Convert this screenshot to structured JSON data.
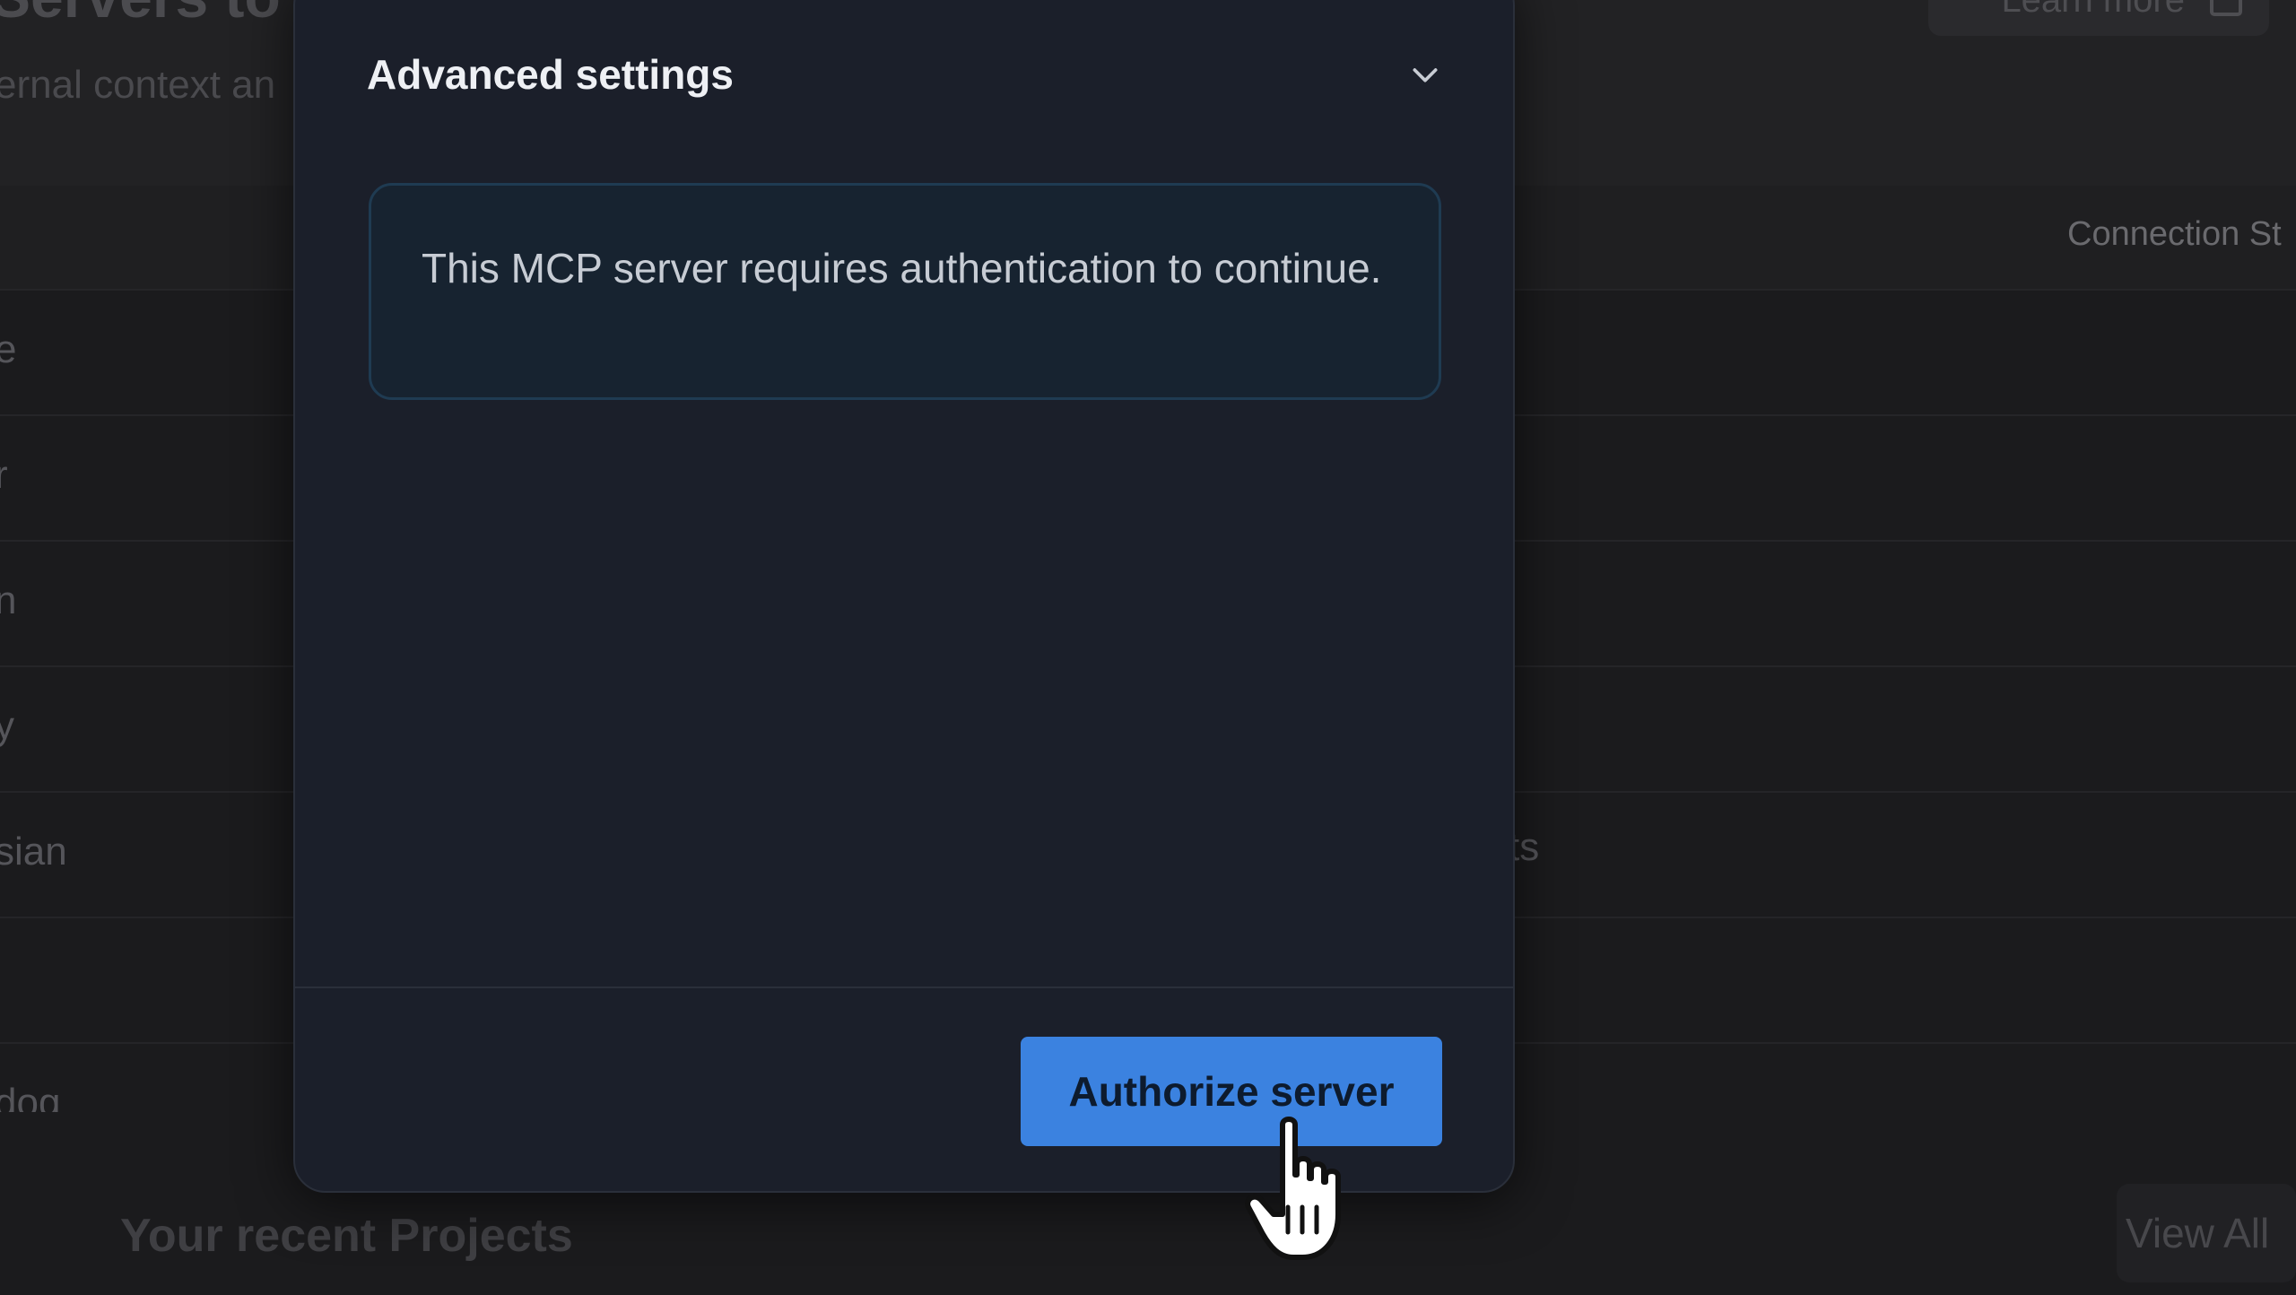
{
  "background": {
    "page_title": "Servers to",
    "page_subtitle": "ernal context an",
    "learn_more_label": "Learn more",
    "column_header": "Connection St",
    "row_labels": [
      "e",
      "r",
      "n",
      "y",
      "sian",
      "",
      "dog"
    ],
    "row_right_text": "cts",
    "recent_projects_label": "Your recent Projects",
    "view_all_label": "View All"
  },
  "modal": {
    "advanced_settings_label": "Advanced settings",
    "alert_message": "This MCP server requires authentication to continue.",
    "authorize_button_label": "Authorize server"
  },
  "colors": {
    "modal_bg": "#1b1f2a",
    "alert_bg": "#172330",
    "alert_border": "#1f3b52",
    "primary_button": "#3b82e0"
  },
  "icons": {
    "chevron": "chevron-down-icon",
    "cursor": "hand-pointer-icon",
    "external": "external-link-icon"
  }
}
